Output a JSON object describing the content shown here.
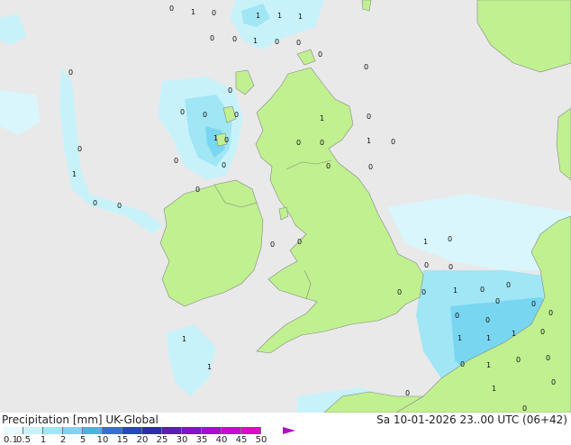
{
  "footer": {
    "title_left": "Precipitation [mm]  UK-Global",
    "title_right": "Sa 10-01-2026 23..00 UTC (06+42)"
  },
  "legend": {
    "ticks": [
      "0.1",
      "0.5",
      "1",
      "2",
      "5",
      "10",
      "15",
      "20",
      "25",
      "30",
      "35",
      "40",
      "45",
      "50"
    ],
    "colors": [
      "#e6faff",
      "#c8f2fa",
      "#a0e6f5",
      "#78d6f0",
      "#46b4e6",
      "#2d73d2",
      "#2846be",
      "#2d2daa",
      "#5a1eb4",
      "#8214c8",
      "#aa0ad2",
      "#c80ad2",
      "#dc0ac8",
      "#b010c0"
    ]
  },
  "colors": {
    "sea": "#e9e9e9",
    "land": "#c0f090",
    "rain_light": "#a0e6f5",
    "rain_moderate": "#78d6f0",
    "rain_heavy": "#46b4e6",
    "border": "#888888"
  },
  "point_values": [
    "0",
    "1",
    "0",
    "1",
    "1",
    "1",
    "0",
    "0",
    "1",
    "0",
    "0",
    "0",
    "0",
    "0",
    "0",
    "0",
    "0",
    "0",
    "1",
    "0",
    "1",
    "0",
    "0",
    "0",
    "1",
    "0",
    "0",
    "0",
    "0",
    "0",
    "1",
    "0",
    "0",
    "0",
    "0",
    "1",
    "0",
    "0",
    "0",
    "0",
    "0",
    "1",
    "0",
    "0",
    "0",
    "0",
    "0",
    "0",
    "0",
    "1",
    "1",
    "1",
    "0",
    "1",
    "1",
    "0",
    "1",
    "0",
    "0",
    "1",
    "0",
    "0",
    "0",
    "0",
    "0"
  ]
}
